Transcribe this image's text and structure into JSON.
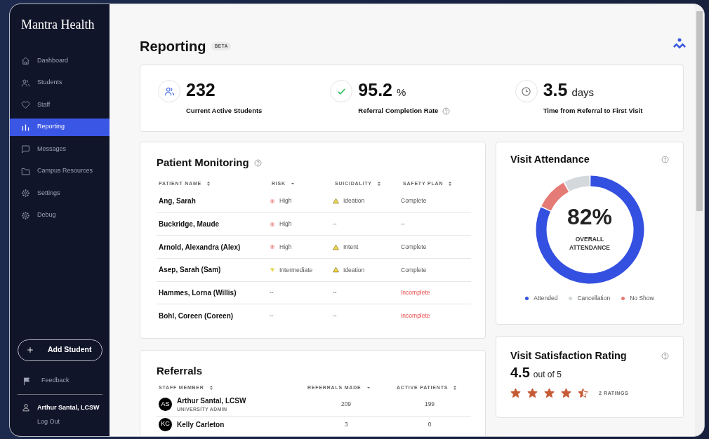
{
  "sidebar": {
    "logo": "Mantra Health",
    "items": [
      {
        "label": "Dashboard",
        "selected": false
      },
      {
        "label": "Students",
        "selected": false
      },
      {
        "label": "Staff",
        "selected": false
      },
      {
        "label": "Reporting",
        "selected": true
      },
      {
        "label": "Messages",
        "selected": false
      },
      {
        "label": "Campus Resources",
        "selected": false
      },
      {
        "label": "Settings",
        "selected": false
      },
      {
        "label": "Debug",
        "selected": false
      }
    ],
    "add_button": "Add Student",
    "feedback": "Feedback",
    "user": {
      "name": "Arthur Santal, LCSW",
      "logout": "Log Out"
    }
  },
  "page": {
    "title": "Reporting",
    "badge": "BETA"
  },
  "stats": [
    {
      "value": "232",
      "label": "Current Active Students",
      "help": false
    },
    {
      "value": "95.2",
      "unit": "%",
      "label": "Referral Completion Rate",
      "help": true
    },
    {
      "value": "3.5",
      "unit": "days",
      "label": "Time from Referral to First Visit",
      "help": false
    }
  ],
  "patient_monitoring": {
    "title": "Patient Monitoring",
    "columns": [
      {
        "label": "PATIENT NAME",
        "sorted": false
      },
      {
        "label": "RISK",
        "sorted": true
      },
      {
        "label": "SUICIDALITY",
        "sorted": false
      },
      {
        "label": "SAFETY PLAN",
        "sorted": false
      }
    ],
    "rows": [
      {
        "name": "Ang, Sarah",
        "risk": {
          "label": "High",
          "kind": "high"
        },
        "suicidality": {
          "label": "Ideation",
          "kind": "warning"
        },
        "safety_plan": {
          "label": "Complete",
          "kind": "complete"
        }
      },
      {
        "name": "Buckridge, Maude",
        "risk": {
          "label": "High",
          "kind": "high"
        },
        "suicidality": {
          "label": "--",
          "kind": "none"
        },
        "safety_plan": {
          "label": "--",
          "kind": "none"
        }
      },
      {
        "name": "Arnold, Alexandra (Alex)",
        "risk": {
          "label": "High",
          "kind": "high"
        },
        "suicidality": {
          "label": "Intent",
          "kind": "warning"
        },
        "safety_plan": {
          "label": "Complete",
          "kind": "complete"
        }
      },
      {
        "name": "Asep, Sarah (Sam)",
        "risk": {
          "label": "Intermediate",
          "kind": "intermediate"
        },
        "suicidality": {
          "label": "Ideation",
          "kind": "warning"
        },
        "safety_plan": {
          "label": "Complete",
          "kind": "complete"
        }
      },
      {
        "name": "Hammes, Lorna (Willis)",
        "risk": {
          "label": "--",
          "kind": "none"
        },
        "suicidality": {
          "label": "--",
          "kind": "none"
        },
        "safety_plan": {
          "label": "Incomplete",
          "kind": "incomplete"
        }
      },
      {
        "name": "Bohl, Coreen (Coreen)",
        "risk": {
          "label": "--",
          "kind": "none"
        },
        "suicidality": {
          "label": "--",
          "kind": "none"
        },
        "safety_plan": {
          "label": "Incomplete",
          "kind": "incomplete"
        }
      }
    ]
  },
  "referrals": {
    "title": "Referrals",
    "columns": [
      {
        "label": "STAFF MEMBER",
        "sorted": false
      },
      {
        "label": "REFERRALS MADE",
        "sorted": true
      },
      {
        "label": "ACTIVE PATIENTS",
        "sorted": false
      }
    ],
    "rows": [
      {
        "initials": "AS",
        "name": "Arthur Santal, LCSW",
        "role": "UNIVERSITY ADMIN",
        "referrals": "209",
        "active": "199"
      },
      {
        "initials": "KC",
        "name": "Kelly Carleton",
        "referrals": "3",
        "active": "0"
      }
    ]
  },
  "visit_attendance": {
    "title": "Visit Attendance",
    "center_value": "82%",
    "center_label": "OVERALL ATTENDANCE",
    "chart_data": {
      "type": "donut",
      "categories": [
        "Attended",
        "Cancellation",
        "No Show"
      ],
      "values": [
        82,
        8,
        10
      ]
    },
    "legend": [
      {
        "color": "#3450e0"
      },
      {
        "color": "#d3d8dc"
      },
      {
        "color": "#e57b76"
      }
    ]
  },
  "visit_satisfaction": {
    "title": "Visit Satisfaction Rating",
    "value": "4.5",
    "suffix": "out of 5",
    "stars": 4.5,
    "count": "2 RATINGS"
  }
}
